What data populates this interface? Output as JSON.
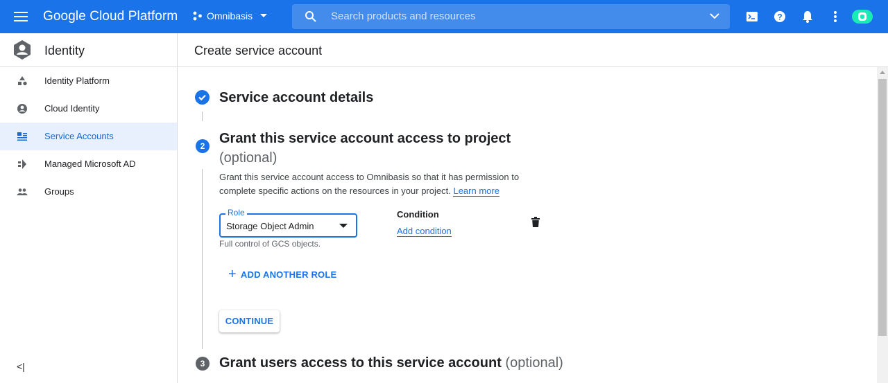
{
  "topbar": {
    "brand": "Google Cloud Platform",
    "project": "Omnibasis",
    "search_placeholder": "Search products and resources",
    "icons": [
      "menu-icon",
      "project-icon",
      "search-icon",
      "chevron-down-icon",
      "cloud-shell-icon",
      "help-icon",
      "notifications-icon",
      "more-vert-icon",
      "account-avatar"
    ]
  },
  "sidebar": {
    "title": "Identity",
    "items": [
      {
        "label": "Identity Platform",
        "icon": "shapes-icon"
      },
      {
        "label": "Cloud Identity",
        "icon": "account-circle-icon"
      },
      {
        "label": "Service Accounts",
        "icon": "service-account-icon",
        "active": true
      },
      {
        "label": "Managed Microsoft AD",
        "icon": "managed-ad-icon"
      },
      {
        "label": "Groups",
        "icon": "groups-icon"
      }
    ],
    "collapse_label": "<|"
  },
  "page": {
    "title": "Create service account"
  },
  "steps": {
    "step1": {
      "title": "Service account details"
    },
    "step2": {
      "number": "2",
      "title": "Grant this service account access to project",
      "optional": "(optional)",
      "description": "Grant this service account access to Omnibasis so that it has permission to complete specific actions on the resources in your project.",
      "learn_more": "Learn more",
      "role_label": "Role",
      "role_value": "Storage Object Admin",
      "role_help": "Full control of GCS objects.",
      "condition_label": "Condition",
      "condition_link": "Add condition",
      "add_role": "ADD ANOTHER ROLE",
      "continue": "CONTINUE"
    },
    "step3": {
      "number": "3",
      "title": "Grant users access to this service account",
      "optional": "(optional)"
    }
  },
  "colors": {
    "topbar": "#1a73e8",
    "accent": "#1a73e8",
    "active_bg": "#e8f0fe",
    "step_inactive": "#5f6368"
  }
}
